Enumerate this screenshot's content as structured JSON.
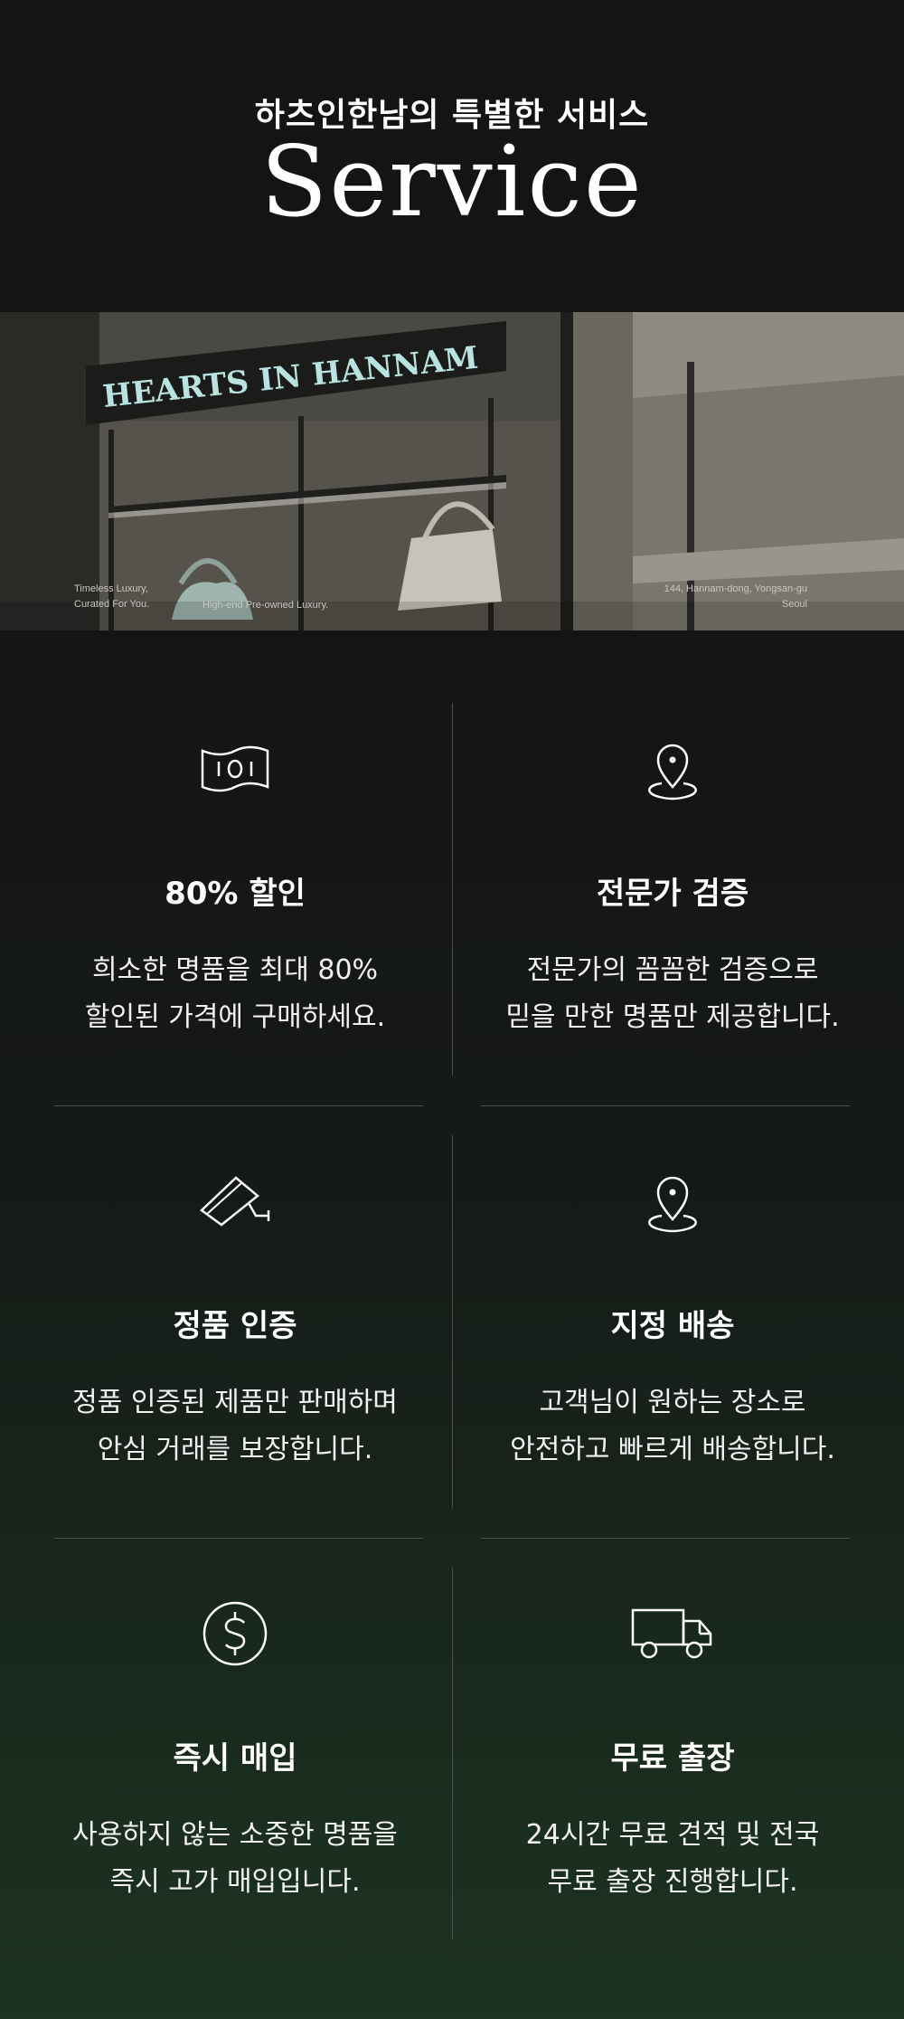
{
  "header": {
    "subtitle": "하츠인한남의 특별한 서비스",
    "title": "Service"
  },
  "banner": {
    "sign_text": "HEARTS IN HANNAM",
    "caption_left_1": "Timeless Luxury,",
    "caption_left_2": "Curated For You.",
    "caption_center": "High-end Pre-owned Luxury.",
    "caption_right_1": "144, Hannam-dong, Yongsan-gu",
    "caption_right_2": "Seoul"
  },
  "services": [
    {
      "icon": "banknote-icon",
      "title": "80% 할인",
      "line1": "희소한 명품을 최대 80%",
      "line2": "할인된 가격에 구매하세요."
    },
    {
      "icon": "location-pin-icon",
      "title": "전문가 검증",
      "line1": "전문가의 꼼꼼한 검증으로",
      "line2": "믿을 만한 명품만 제공합니다."
    },
    {
      "icon": "security-camera-icon",
      "title": "정품 인증",
      "line1": "정품 인증된 제품만 판매하며",
      "line2": "안심 거래를 보장합니다."
    },
    {
      "icon": "location-pin-icon",
      "title": "지정 배송",
      "line1": "고객님이 원하는 장소로",
      "line2": "안전하고 빠르게 배송합니다."
    },
    {
      "icon": "dollar-coin-icon",
      "title": "즉시 매입",
      "line1": "사용하지 않는 소중한 명품을",
      "line2": "즉시 고가 매입입니다."
    },
    {
      "icon": "delivery-truck-icon",
      "title": "무료 출장",
      "line1": "24시간 무료 견적 및 전국",
      "line2": "무료 출장 진행합니다."
    }
  ],
  "colors": {
    "background": "#141416",
    "bottom_gradient": "#1c3321",
    "divider": "#4a4d4b",
    "text": "#ffffff"
  }
}
